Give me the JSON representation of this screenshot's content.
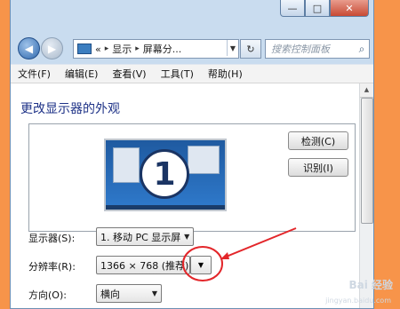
{
  "window": {
    "caption": {
      "minimize": "—",
      "maximize": "□",
      "close": "✕"
    },
    "nav": {
      "back_icon": "back-arrow-icon",
      "forward_icon": "forward-arrow-icon"
    },
    "address": {
      "prefix": "«",
      "crumbs": [
        "显示",
        "屏幕分..."
      ],
      "separator": "▸"
    },
    "search": {
      "placeholder": "搜索控制面板"
    },
    "menu": [
      "文件(F)",
      "编辑(E)",
      "查看(V)",
      "工具(T)",
      "帮助(H)"
    ]
  },
  "main": {
    "title": "更改显示器的外观",
    "monitor_badge": "1",
    "detect_button": "检测(C)",
    "identify_button": "识别(I)",
    "display_label": "显示器(S):",
    "display_value": "1. 移动 PC 显示屏",
    "resolution_label": "分辨率(R):",
    "resolution_value": "1366 × 768 (推荐)",
    "orientation_label": "方向(O):",
    "orientation_value": "横向"
  },
  "annotation": {
    "color": "#e3262a"
  },
  "watermark": {
    "text": "Bai 经验",
    "subtext": "jingyan.baidu.com"
  },
  "colors": {
    "background": "#f7944a",
    "title": "#1e3287",
    "chrome": "#c9dcef"
  }
}
